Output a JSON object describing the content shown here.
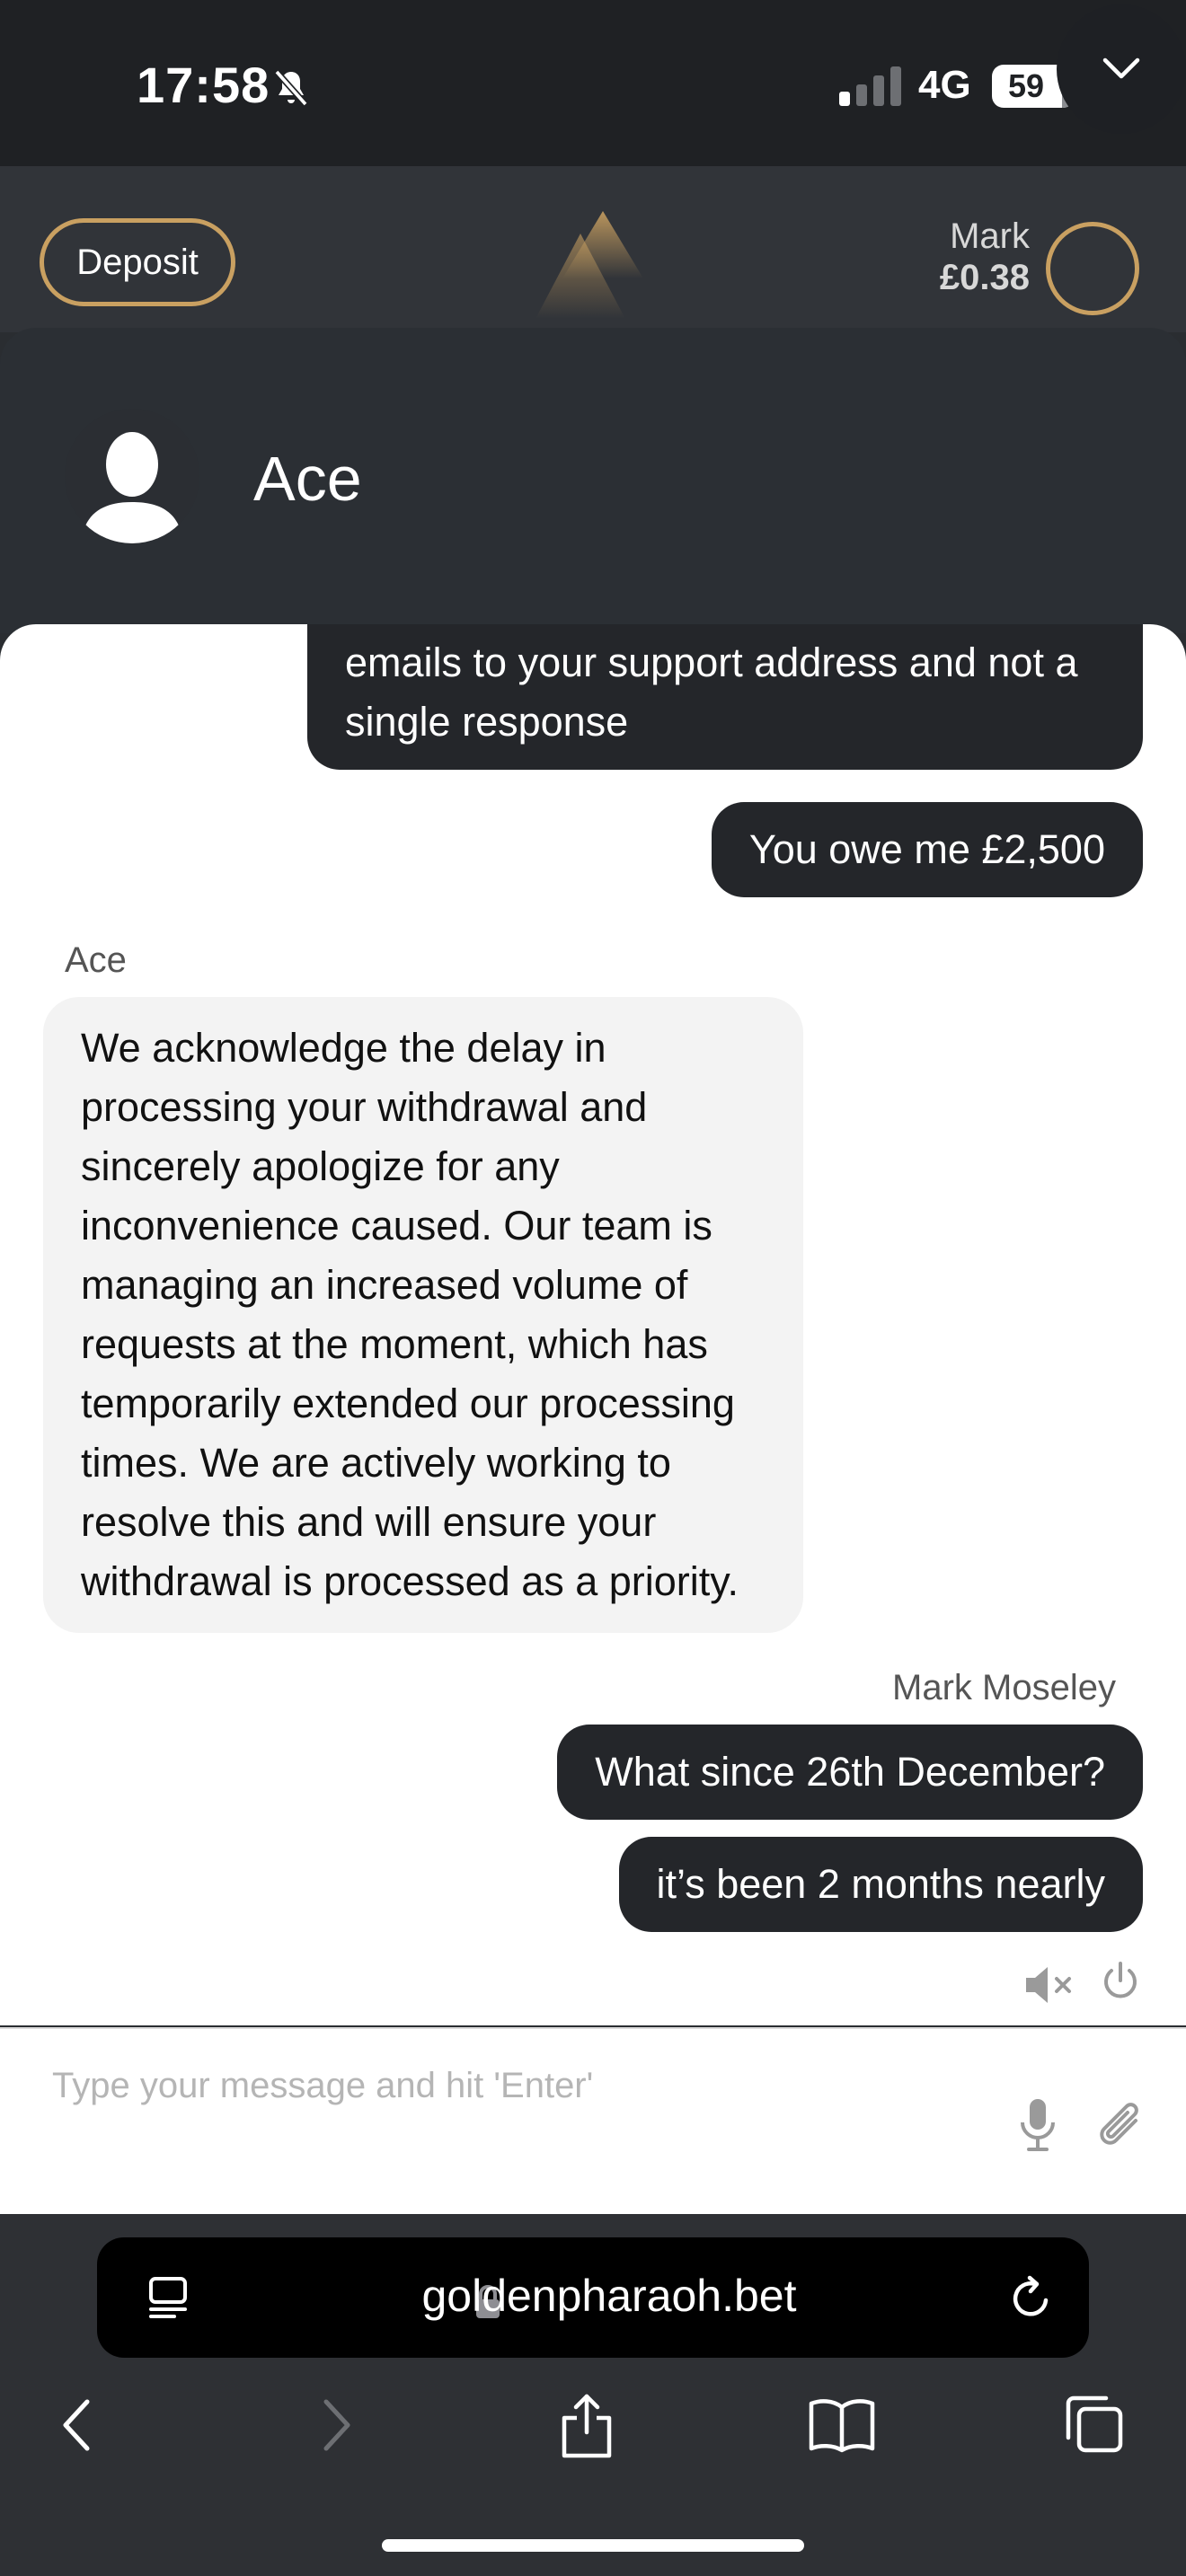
{
  "status_bar": {
    "time": "17:58",
    "network": "4G",
    "battery": "59"
  },
  "site_header": {
    "deposit_label": "Deposit",
    "user_name": "Mark",
    "balance": "£0.38"
  },
  "chat": {
    "agent_name": "Ace",
    "messages": [
      {
        "from": "user",
        "text": "emails to your support address and not a single response"
      },
      {
        "from": "user",
        "text": "You owe me £2,500"
      },
      {
        "from": "agent",
        "sender": "Ace",
        "text": "We acknowledge the delay in processing your withdrawal and sincerely apologize for any inconvenience caused. Our team is managing an increased volume of requests at the moment, which has temporarily extended our processing times. We are actively working to resolve this and will ensure your withdrawal is processed as a priority."
      },
      {
        "from": "user",
        "sender": "Mark Moseley",
        "text": "What since 26th December?"
      },
      {
        "from": "user",
        "text": "it’s been 2 months nearly"
      }
    ],
    "input_placeholder": "Type your message and hit 'Enter'"
  },
  "browser": {
    "url": "goldenpharaoh.bet"
  },
  "colors": {
    "accent_gold": "#c9a061",
    "user_bubble": "#24262a",
    "agent_bubble": "#f3f3f3"
  }
}
